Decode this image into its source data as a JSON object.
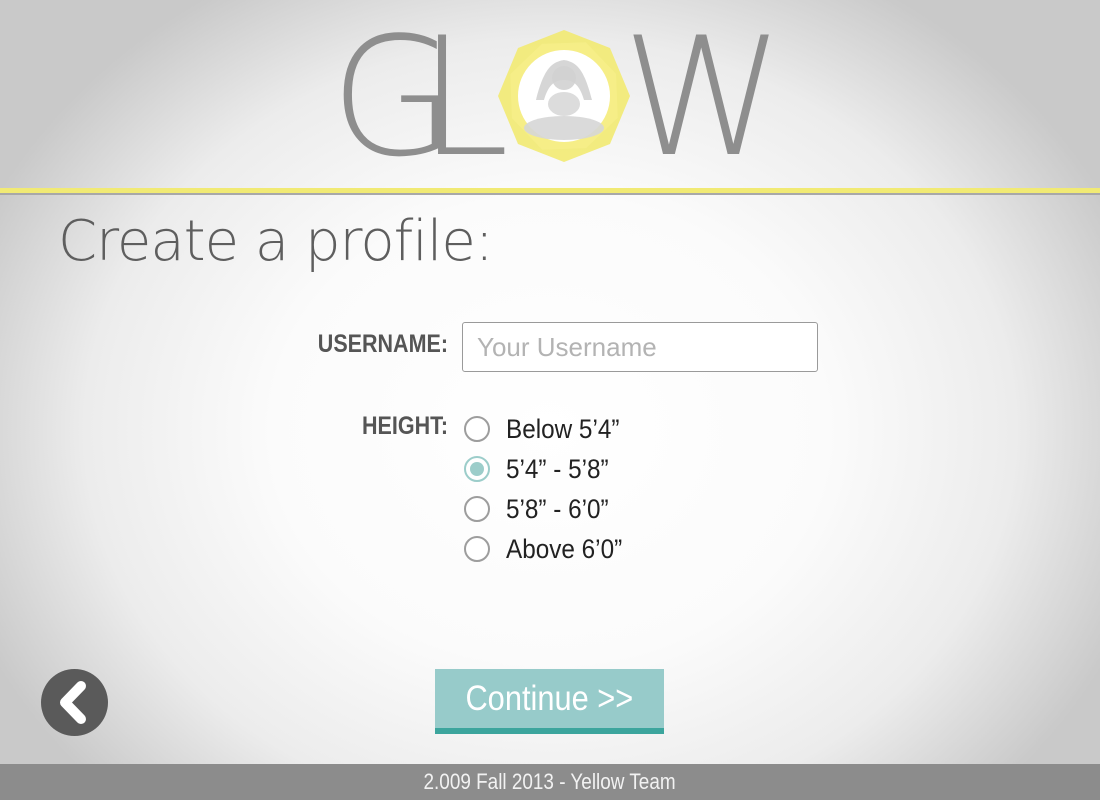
{
  "logo": {
    "letters": [
      "G",
      "L",
      "W"
    ],
    "accent_color": "#f1ea74",
    "icon": "meditating-figure-icon"
  },
  "page_title": "Create a profile:",
  "form": {
    "username_label": "USERNAME:",
    "username_value": "",
    "username_placeholder": "Your Username",
    "height_label": "HEIGHT:",
    "height_options": [
      {
        "label": "Below 5’4”",
        "selected": false
      },
      {
        "label": "5’4” - 5’8”",
        "selected": true
      },
      {
        "label": "5’8” - 6’0”",
        "selected": false
      },
      {
        "label": "Above 6’0”",
        "selected": false
      }
    ]
  },
  "actions": {
    "continue_label": "Continue >>",
    "back_icon": "chevron-left-icon"
  },
  "footer": {
    "text": "2.009 Fall 2013 - Yellow Team"
  },
  "colors": {
    "accent_teal": "#97cbca",
    "accent_teal_dark": "#3ca59d",
    "accent_yellow": "#f1ea74",
    "footer_bg": "#8c8c8c"
  }
}
